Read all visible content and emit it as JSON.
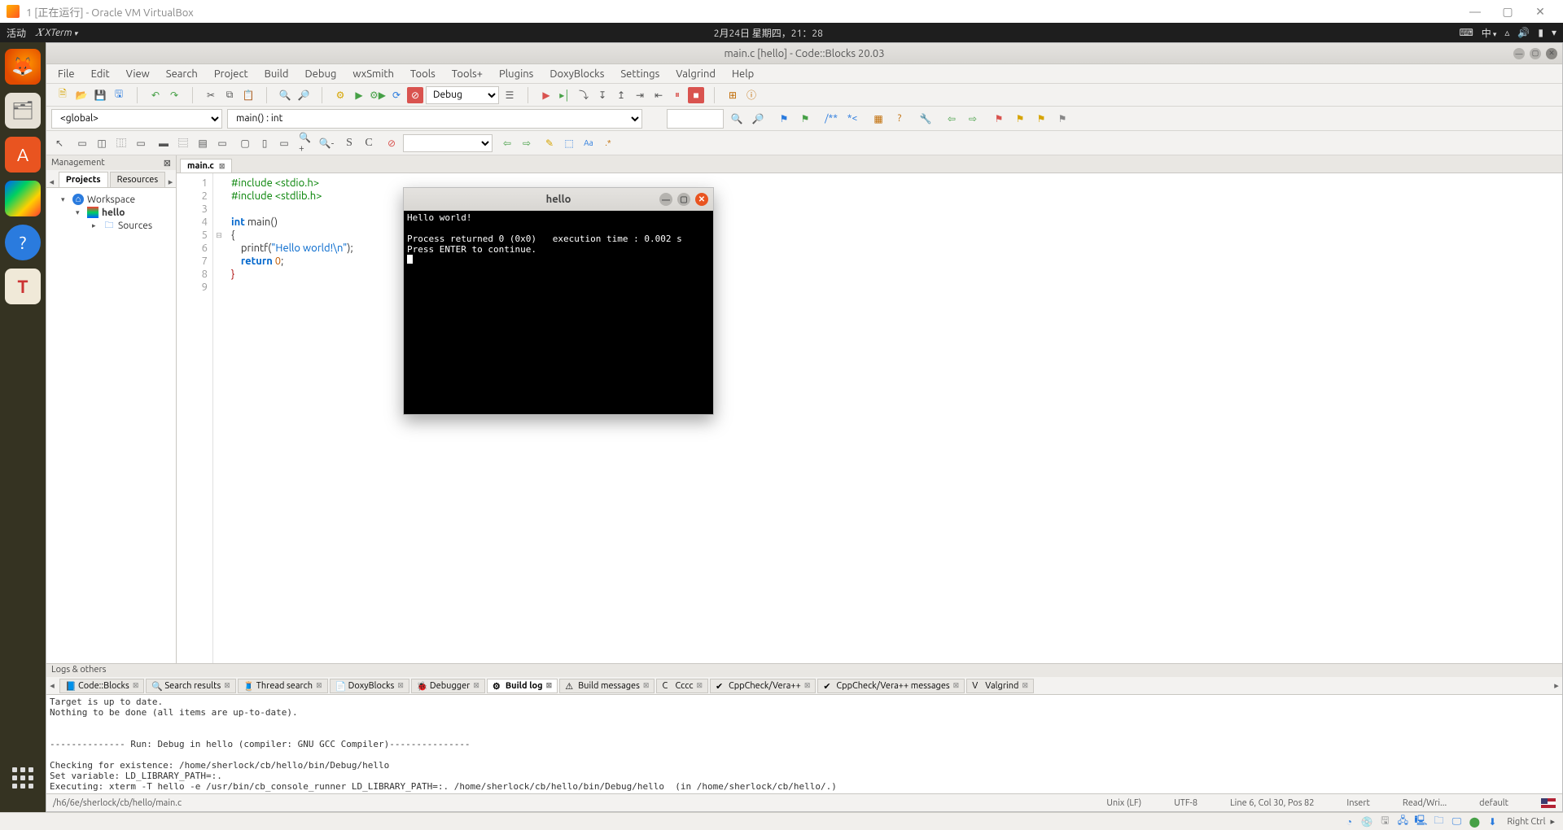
{
  "vbox": {
    "title": "1 [正在运行] - Oracle VM VirtualBox",
    "status_right": "Right Ctrl"
  },
  "ubuntu_panel": {
    "activities": "活动",
    "app": "XTerm",
    "clock": "2月24日 星期四，21：28",
    "lang": "中"
  },
  "cb": {
    "title": "main.c [hello] - Code::Blocks 20.03",
    "menus": [
      "File",
      "Edit",
      "View",
      "Search",
      "Project",
      "Build",
      "Debug",
      "wxSmith",
      "Tools",
      "Tools+",
      "Plugins",
      "DoxyBlocks",
      "Settings",
      "Valgrind",
      "Help"
    ],
    "build_target": "Debug",
    "scope_select": "<global>",
    "func_select": "main() : int",
    "mgmt_title": "Management",
    "mgmt_tabs": [
      "Projects",
      "Resources"
    ],
    "tree": {
      "workspace": "Workspace",
      "project": "hello",
      "sources": "Sources"
    },
    "file_tab": "main.c",
    "code_lines": [
      {
        "n": "1",
        "html": "<span class='pp'>#include &lt;stdio.h&gt;</span>"
      },
      {
        "n": "2",
        "html": "<span class='pp'>#include &lt;stdlib.h&gt;</span>"
      },
      {
        "n": "3",
        "html": ""
      },
      {
        "n": "4",
        "html": "<span class='kw'>int</span> <span class='fn'>main</span>()"
      },
      {
        "n": "5",
        "html": "{",
        "fold": "⊟"
      },
      {
        "n": "6",
        "html": "    printf(<span class='str'>\"Hello world!\\n\"</span>);"
      },
      {
        "n": "7",
        "html": "    <span class='kw'>return</span> <span class='num'>0</span>;"
      },
      {
        "n": "8",
        "html": "<span class='brace'>}</span>"
      },
      {
        "n": "9",
        "html": ""
      }
    ],
    "logs_title": "Logs & others",
    "log_tabs": [
      "Code::Blocks",
      "Search results",
      "Thread search",
      "DoxyBlocks",
      "Debugger",
      "Build log",
      "Build messages",
      "Cccc",
      "CppCheck/Vera++",
      "CppCheck/Vera++ messages",
      "Valgrind"
    ],
    "log_active": 5,
    "log_text": "Target is up to date.\nNothing to be done (all items are up-to-date).\n\n\n-------------- Run: Debug in hello (compiler: GNU GCC Compiler)---------------\n\nChecking for existence: /home/sherlock/cb/hello/bin/Debug/hello\nSet variable: LD_LIBRARY_PATH=:.\nExecuting: xterm -T hello -e /usr/bin/cb_console_runner LD_LIBRARY_PATH=:. /home/sherlock/cb/hello/bin/Debug/hello  (in /home/sherlock/cb/hello/.)",
    "status": {
      "path": "/home/sherlock/cb/hello/main.c",
      "path_overlay": "/h6/6e/sherlock/cb/hello/main.c",
      "eol": "Unix (LF)",
      "enc": "UTF-8",
      "pos": "Line 6, Col 30, Pos 82",
      "ins": "Insert",
      "rw": "Read/Wri...",
      "profile": "default"
    }
  },
  "xterm": {
    "title": "hello",
    "lines": [
      "Hello world!",
      "",
      "Process returned 0 (0x0)   execution time : 0.002 s",
      "Press ENTER to continue."
    ]
  }
}
